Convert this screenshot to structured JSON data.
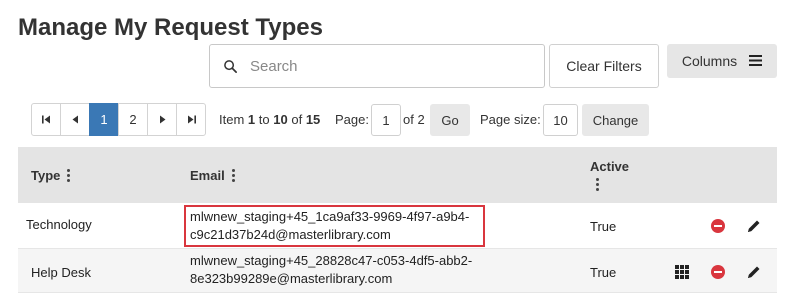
{
  "page": {
    "title": "Manage My Request Types"
  },
  "toolbar": {
    "search_placeholder": "Search",
    "clear_filters_label": "Clear Filters",
    "columns_label": "Columns"
  },
  "pagination": {
    "pages": [
      "1",
      "2"
    ],
    "current_page": "1",
    "item_prefix": "Item",
    "item_from": "1",
    "item_to_word": "to",
    "item_to": "10",
    "item_of_word": "of",
    "item_total": "15",
    "page_label": "Page:",
    "page_value": "1",
    "page_of": "of 2",
    "go_label": "Go",
    "page_size_label": "Page size:",
    "page_size_value": "10",
    "change_label": "Change"
  },
  "table": {
    "columns": [
      "Type",
      "Email",
      "Active"
    ],
    "rows": [
      {
        "type": "Technology",
        "email_line1": "mlwnew_staging+45_1ca9af33-9969-4f97-a9b4-",
        "email_line2": "c9c21d37b24d@masterlibrary.com",
        "active": "True"
      },
      {
        "type": "Help Desk",
        "email_line1": "mlwnew_staging+45_28828c47-c053-4df5-abb2-",
        "email_line2": "8e323b99289e@masterlibrary.com",
        "active": "True"
      }
    ]
  },
  "colors": {
    "accent": "#3a78b5",
    "header_bg": "#e4e4e4",
    "delete_red": "#d9363e",
    "highlight_border": "#d9363e"
  }
}
